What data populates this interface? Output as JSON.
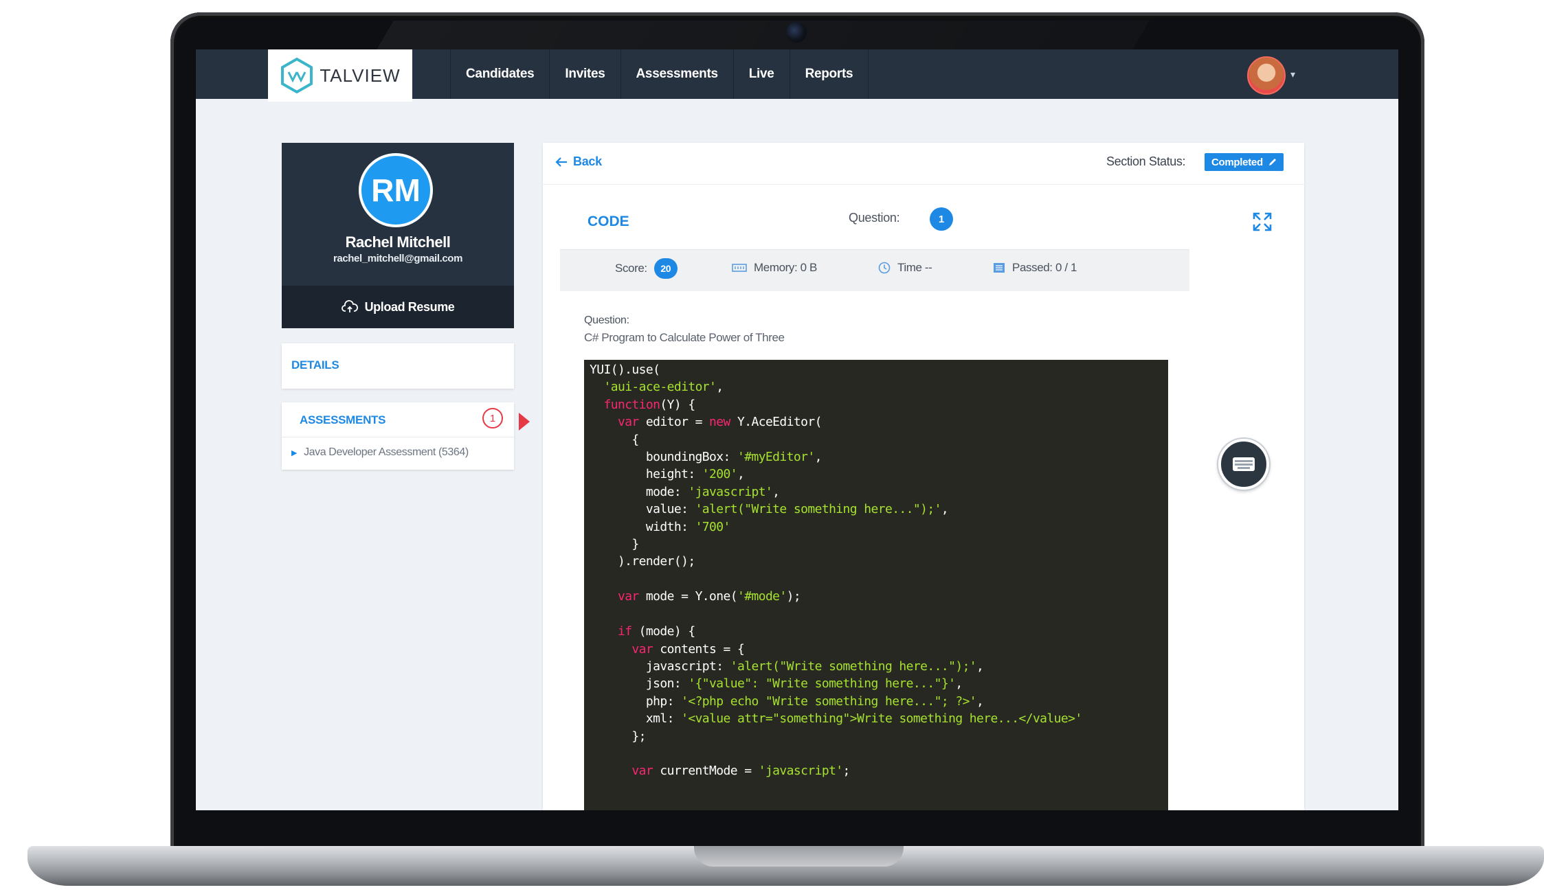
{
  "navbar": {
    "logo_text": "TALVIEW",
    "items": [
      {
        "label": "Candidates"
      },
      {
        "label": "Invites"
      },
      {
        "label": "Assessments"
      },
      {
        "label": "Live"
      },
      {
        "label": "Reports"
      }
    ],
    "avatar_icon": "user-avatar",
    "caret": "▾"
  },
  "profile": {
    "initials": "RM",
    "name": "Rachel Mitchell",
    "email": "rachel_mitchell@gmail.com",
    "upload_label": "Upload Resume"
  },
  "sidebar": {
    "details_label": "DETAILS",
    "assessments_label": "ASSESSMENTS",
    "assessments_count": "1",
    "assessment_items": [
      {
        "label": "Java Developer Assessment (5364)"
      }
    ]
  },
  "panel": {
    "back_label": "Back",
    "section_status_label": "Section Status:",
    "section_status_value": "Completed",
    "tab_label": "CODE",
    "question_label": "Question:",
    "question_number": "1",
    "metrics": {
      "score_label": "Score:",
      "score_value": "20",
      "memory": "Memory: 0 B",
      "time": "Time --",
      "passed": "Passed: 0 / 1"
    },
    "question_heading": "Question:",
    "question_text": "C# Program to Calculate Power of Three",
    "code_lines": [
      "YUI().use(",
      "  'aui-ace-editor',",
      "  function(Y) {",
      "    var editor = new Y.AceEditor(",
      "      {",
      "        boundingBox: '#myEditor',",
      "        height: '200',",
      "        mode: 'javascript',",
      "        value: 'alert(\"Write something here...\");',",
      "        width: '700'",
      "      }",
      "    ).render();",
      "",
      "    var mode = Y.one('#mode');",
      "",
      "    if (mode) {",
      "      var contents = {",
      "        javascript: 'alert(\"Write something here...\");',",
      "        json: '{\"value\": \"Write something here...\"}',",
      "        php: '<?php echo \"Write something here...\"; ?>',",
      "        xml: '<value attr=\"something\">Write something here...</value>'",
      "      };",
      "",
      "      var currentMode = 'javascript';"
    ]
  },
  "icons": {
    "back": "arrow-left-icon",
    "edit": "pencil-icon",
    "expand": "expand-icon",
    "memory": "memory-icon",
    "time": "clock-icon",
    "passed": "list-icon",
    "upload": "cloud-upload-icon",
    "keyboard": "keyboard-icon"
  },
  "colors": {
    "navbar": "#263240",
    "accent": "#1e88e5",
    "alert": "#e53945",
    "code_bg": "#272822",
    "code_keyword": "#f92672",
    "code_string": "#a6e22e"
  }
}
